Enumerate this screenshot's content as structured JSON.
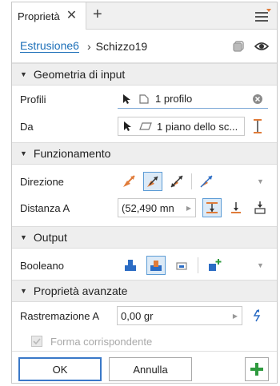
{
  "tab": {
    "label": "Proprietà",
    "close": "✕",
    "add": "+"
  },
  "breadcrumb": {
    "feature": "Estrusione6",
    "separator": "›",
    "sketch": "Schizzo19"
  },
  "sections": {
    "input": "Geometria di input",
    "behavior": "Funzionamento",
    "output": "Output",
    "advanced": "Proprietà avanzate"
  },
  "input": {
    "profiles_label": "Profili",
    "profiles_value": "1 profilo",
    "from_label": "Da",
    "from_value": "1 piano dello sc..."
  },
  "behavior": {
    "direction_label": "Direzione",
    "distance_label": "Distanza A",
    "distance_value": "(52,490 mn"
  },
  "output": {
    "boolean_label": "Booleano"
  },
  "advanced": {
    "taper_label": "Rastremazione A",
    "taper_value": "0,00 gr",
    "match_shape_label": "Forma corrispondente"
  },
  "footer": {
    "ok": "OK",
    "cancel": "Annulla",
    "plus": "+"
  },
  "colors": {
    "accent": "#1c6fb8",
    "active_bg": "#dceaf7",
    "orange": "#e07b39",
    "green": "#2e9a3e",
    "blue": "#2b6cc4"
  }
}
